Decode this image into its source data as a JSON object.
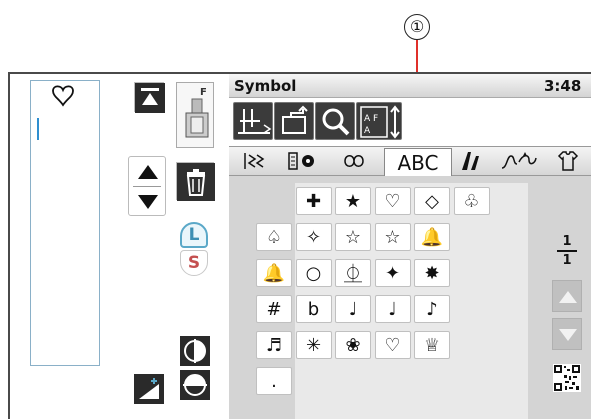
{
  "callout": {
    "label": "①"
  },
  "header": {
    "title": "Symbol",
    "time": "3:48"
  },
  "toolbar": {
    "tools": [
      "needle-position-icon",
      "memory-return-icon",
      "zoom-icon",
      "character-spacing-icon"
    ]
  },
  "foot_label": "F",
  "lock_buttons": {
    "large": "L",
    "small": "S"
  },
  "tabs": {
    "items": [
      {
        "name": "stitch-tab-icon"
      },
      {
        "name": "buttonhole-tab-icon"
      },
      {
        "name": "decorative-tab-icon"
      },
      {
        "name": "abc",
        "label": "ABC",
        "selected": true
      },
      {
        "name": "satin-tab-icon"
      },
      {
        "name": "applique-tab-icon"
      },
      {
        "name": "garment-tab-icon"
      }
    ]
  },
  "symbols": {
    "rows": [
      [
        "",
        "✚",
        "★",
        "♡",
        "◇",
        "♧"
      ],
      [
        "♤",
        "✧",
        "☆",
        "☆",
        "🔔",
        ""
      ],
      [
        "🔔",
        "○",
        "⏂",
        "✦",
        "✸",
        ""
      ],
      [
        "#",
        "b",
        "♩",
        "♩",
        "♪",
        ""
      ],
      [
        "♬",
        "✳",
        "❀",
        "♡",
        "♕",
        ""
      ],
      [
        ".",
        "",
        "",
        "",
        "",
        ""
      ]
    ]
  },
  "page": {
    "current": "1",
    "total": "1"
  },
  "colors": {
    "accent": "#5aa8c8",
    "callout_line": "#e0302a",
    "tool_bg": "#3b3b3b"
  }
}
